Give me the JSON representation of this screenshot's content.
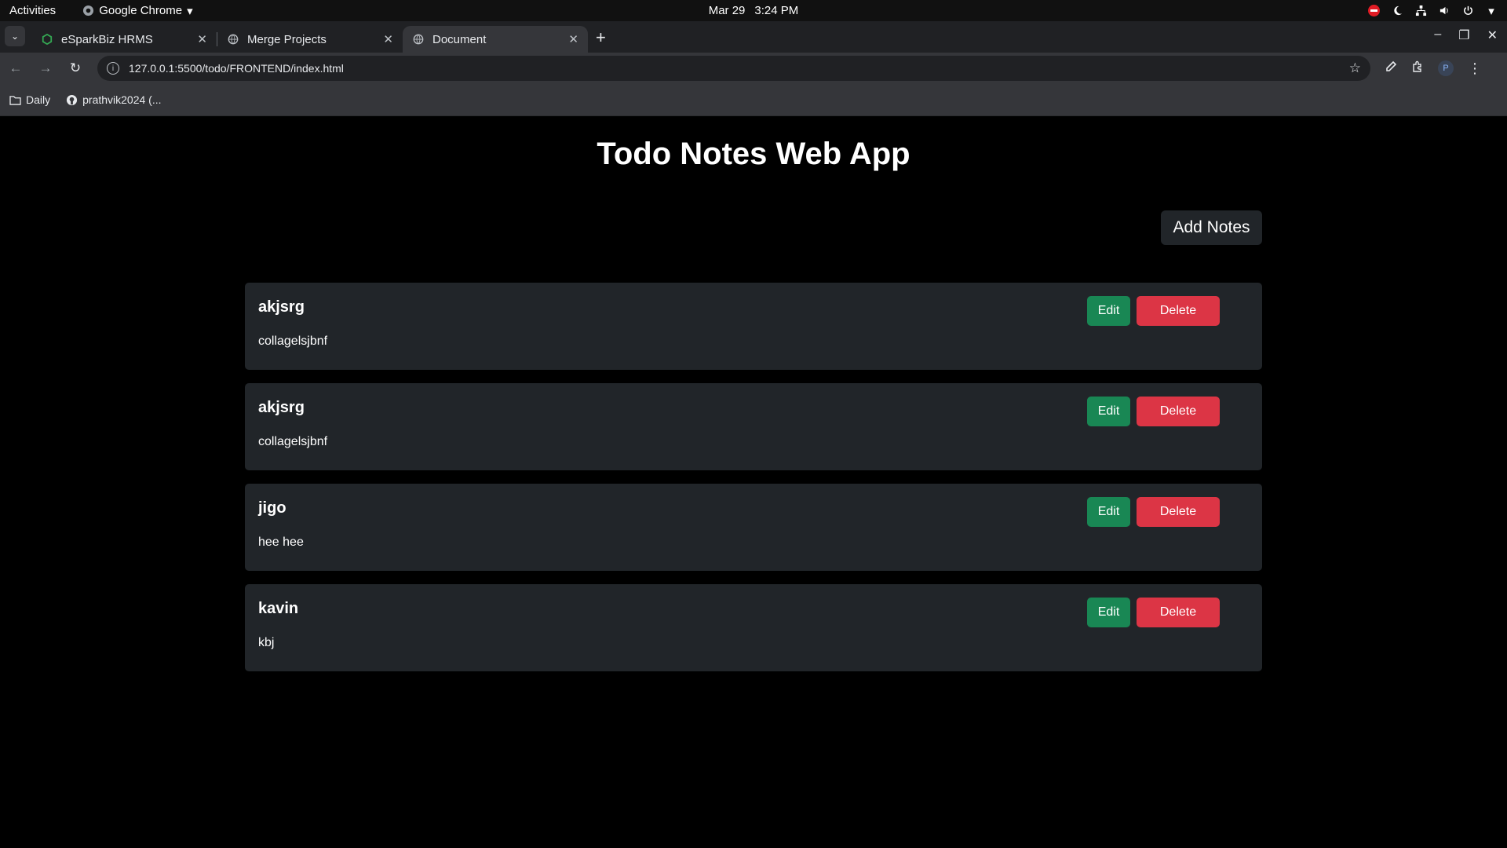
{
  "system_bar": {
    "activities": "Activities",
    "app_name": "Google Chrome",
    "date": "Mar 29",
    "time": "3:24 PM"
  },
  "browser": {
    "tabs": [
      {
        "title": "eSparkBiz HRMS",
        "icon": "esparkbiz-favicon",
        "active": false
      },
      {
        "title": "Merge Projects",
        "icon": "globe-icon",
        "active": false
      },
      {
        "title": "Document",
        "icon": "globe-icon",
        "active": true
      }
    ],
    "url": "127.0.0.1:5500/todo/FRONTEND/index.html",
    "bookmarks": [
      {
        "label": "Daily",
        "icon": "folder-icon"
      },
      {
        "label": "prathvik2024 (...",
        "icon": "github-icon"
      }
    ],
    "profile_initial": "P"
  },
  "app": {
    "title": "Todo Notes Web App",
    "add_button": "Add Notes",
    "edit_label": "Edit",
    "delete_label": "Delete",
    "notes": [
      {
        "title": "akjsrg",
        "body": "collagelsjbnf"
      },
      {
        "title": "akjsrg",
        "body": "collagelsjbnf"
      },
      {
        "title": "jigo",
        "body": "hee hee"
      },
      {
        "title": "kavin",
        "body": "kbj"
      }
    ]
  },
  "colors": {
    "edit": "#198754",
    "delete": "#dc3545",
    "card": "#212529",
    "background": "#000000"
  }
}
